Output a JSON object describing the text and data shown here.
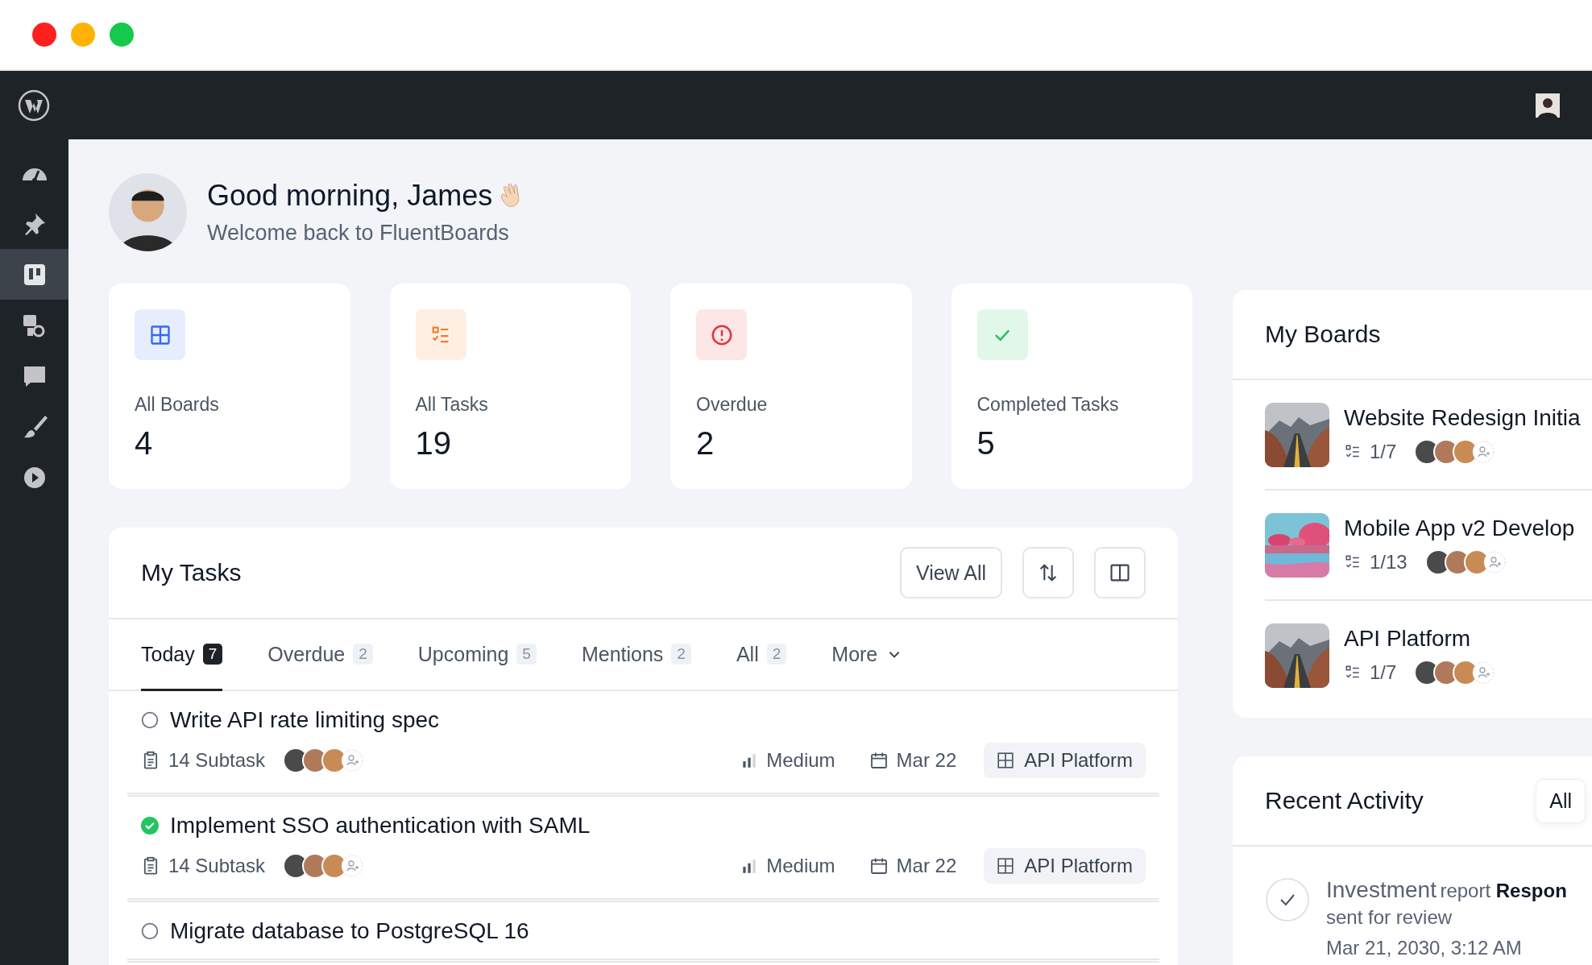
{
  "window": {
    "controls": [
      {
        "color": "#ff1f1f"
      },
      {
        "color": "#ffb300"
      },
      {
        "color": "#14c94b"
      }
    ]
  },
  "sidebar": {
    "items": [
      {
        "kind": "dashboard",
        "selected": false
      },
      {
        "kind": "pin",
        "selected": false
      },
      {
        "kind": "boards",
        "selected": true
      },
      {
        "kind": "media",
        "selected": false
      },
      {
        "kind": "comments",
        "selected": false
      },
      {
        "kind": "brush",
        "selected": false
      },
      {
        "kind": "play",
        "selected": false
      }
    ]
  },
  "greeting": {
    "title": "Good morning, James",
    "subtitle": "Welcome back to FluentBoards"
  },
  "stats": [
    {
      "kind": "boards",
      "label": "All Boards",
      "value": "4"
    },
    {
      "kind": "tasks",
      "label": "All Tasks",
      "value": "19"
    },
    {
      "kind": "overdue",
      "label": "Overdue",
      "value": "2"
    },
    {
      "kind": "completed",
      "label": "Completed Tasks",
      "value": "5"
    }
  ],
  "my_tasks": {
    "title": "My Tasks",
    "view_all": "View All",
    "more": "More",
    "tabs": [
      {
        "label": "Today",
        "count": "7",
        "selected": true
      },
      {
        "label": "Overdue",
        "count": "2",
        "selected": false
      },
      {
        "label": "Upcoming",
        "count": "5",
        "selected": false
      },
      {
        "label": "Mentions",
        "count": "2",
        "selected": false
      },
      {
        "label": "All",
        "count": "2",
        "selected": false
      }
    ],
    "items": [
      {
        "title": "Write API rate limiting spec",
        "done": false,
        "subtasks": "14 Subtask",
        "assignees": [
          {
            "color": "#4a4a4a"
          },
          {
            "color": "#b07a5a"
          },
          {
            "color": "#c98b55"
          }
        ],
        "priority": "Medium",
        "due": "Mar 22",
        "board": "API Platform"
      },
      {
        "title": "Implement SSO authentication with SAML",
        "done": true,
        "subtasks": "14 Subtask",
        "assignees": [
          {
            "color": "#4a4a4a"
          },
          {
            "color": "#b07a5a"
          },
          {
            "color": "#c98b55"
          }
        ],
        "priority": "Medium",
        "due": "Mar 22",
        "board": "API Platform"
      },
      {
        "title": "Migrate database to PostgreSQL 16",
        "done": false
      }
    ]
  },
  "my_boards": {
    "title": "My Boards",
    "items": [
      {
        "name": "Website Redesign Initia",
        "progress": "1/7",
        "assignees": [
          {
            "color": "#4a4a4a"
          },
          {
            "color": "#b07a5a"
          },
          {
            "color": "#c98b55"
          }
        ]
      },
      {
        "name": "Mobile App v2 Develop",
        "progress": "1/13",
        "assignees": [
          {
            "color": "#4a4a4a"
          },
          {
            "color": "#b07a5a"
          },
          {
            "color": "#c98b55"
          }
        ]
      },
      {
        "name": "API Platform",
        "progress": "1/7",
        "assignees": [
          {
            "color": "#4a4a4a"
          },
          {
            "color": "#b07a5a"
          },
          {
            "color": "#c98b55"
          }
        ]
      }
    ]
  },
  "recent_activity": {
    "title": "Recent Activity",
    "filter": "All",
    "items": [
      {
        "subject": "Investment",
        "action": "report **Respon**",
        "detail": "sent for review",
        "time": "Mar 21, 2030, 3:12 AM"
      }
    ]
  }
}
